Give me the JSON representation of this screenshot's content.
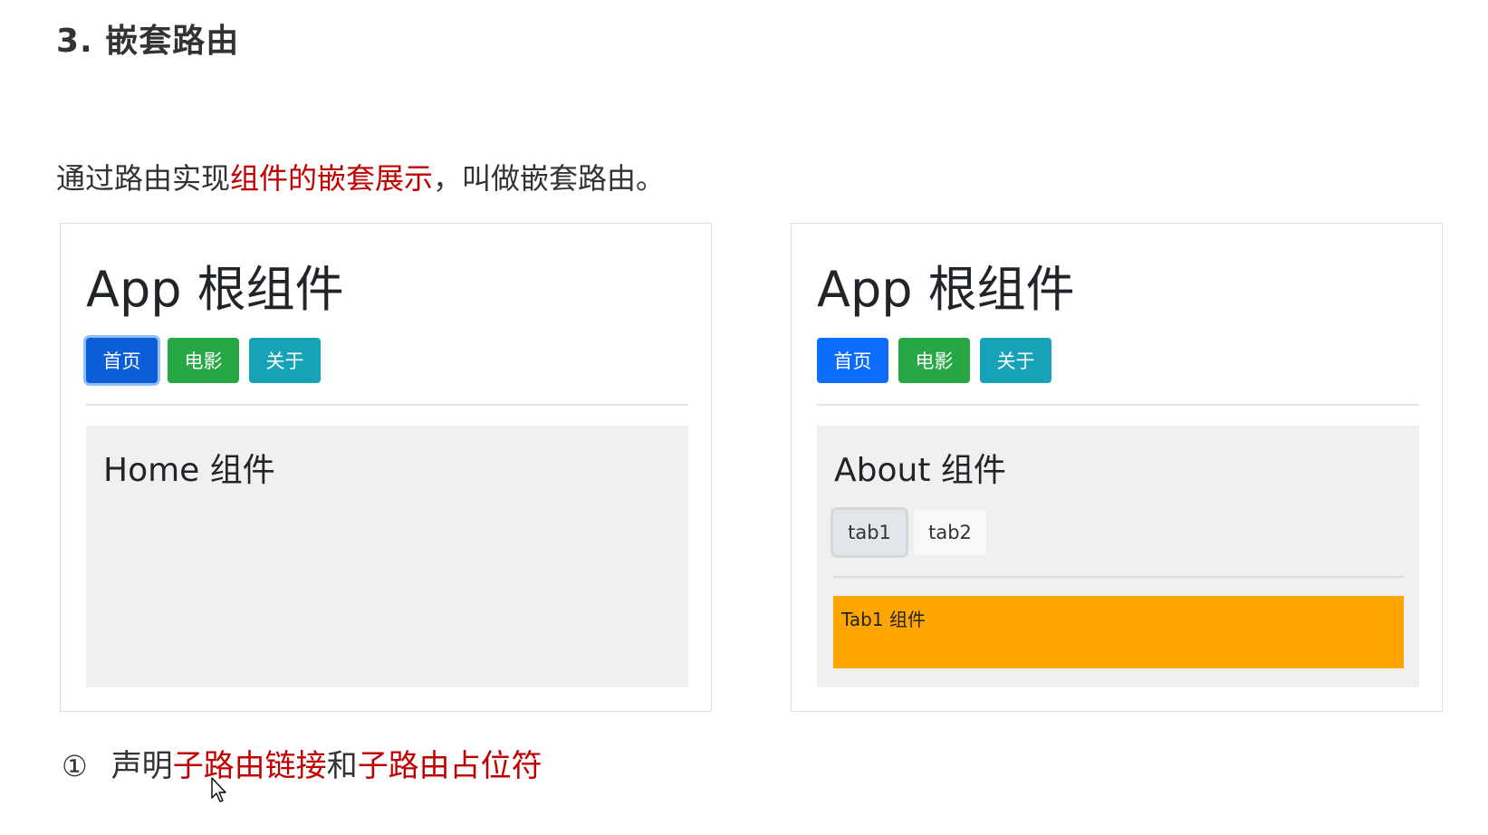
{
  "heading": "3. 嵌套路由",
  "intro": {
    "part1": "通过路由实现",
    "highlight": "组件的嵌套展示",
    "part2": "，叫做嵌套路由。"
  },
  "left_panel": {
    "app_title": "App 根组件",
    "nav": [
      "首页",
      "电影",
      "关于"
    ],
    "active_nav": "首页",
    "content_title": "Home 组件"
  },
  "right_panel": {
    "app_title": "App 根组件",
    "nav": [
      "首页",
      "电影",
      "关于"
    ],
    "content_title": "About 组件",
    "tabs": [
      "tab1",
      "tab2"
    ],
    "active_tab": "tab1",
    "tab_content": "Tab1 组件"
  },
  "step": {
    "marker": "①",
    "text1": "声明",
    "highlight1": "子路由链接",
    "text2": "和",
    "highlight2": "子路由占位符"
  },
  "colors": {
    "highlight": "#c00000",
    "btn_home": "#0d6efd",
    "btn_movie": "#28a745",
    "btn_about": "#17a2b8",
    "inner_bg": "#f0f0f0",
    "tab_content_bg": "#ffa500"
  },
  "icons": {
    "cursor": "mouse-pointer-icon"
  }
}
